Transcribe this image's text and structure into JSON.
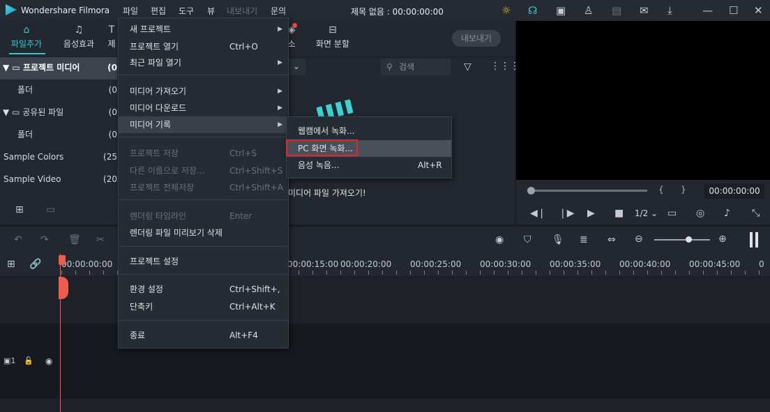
{
  "app": {
    "name": "Wondershare Filmora",
    "doc_title": "제목 없음 : 00:00:00:00"
  },
  "menubar": [
    "파일",
    "편집",
    "도구",
    "뷰",
    "내보내기",
    "문의"
  ],
  "title_icons": [
    "bulb-icon",
    "headset-icon",
    "gift-icon",
    "user-icon",
    "save-icon",
    "mail-icon",
    "download-icon",
    "minimize-icon",
    "maximize-icon",
    "close-icon"
  ],
  "tabs": [
    {
      "label": "파일추가",
      "icon": "folder-icon"
    },
    {
      "label": "음성효과",
      "icon": "music-icon"
    },
    {
      "label": "소",
      "icon": "element-icon"
    },
    {
      "label": "화면 분할",
      "icon": "split-screen-icon"
    }
  ],
  "tab_partial_left": "제",
  "export_label": "내보내기",
  "tree": [
    {
      "label": "프로젝트 미디어",
      "count": "(0",
      "expand": true
    },
    {
      "label": "폴더",
      "count": "(0"
    },
    {
      "label": "공유된 파일",
      "count": "(0",
      "expand": true
    },
    {
      "label": "폴더",
      "count": "(0"
    },
    {
      "label": "Sample Colors",
      "count": "(25"
    },
    {
      "label": "Sample Video",
      "count": "(20"
    }
  ],
  "search_placeholder": "검색",
  "empty_text": "미디어 파일 가져오기!",
  "preview": {
    "time": "00:00:00:00",
    "ratio": "1/2"
  },
  "ruler_labels": [
    "00:00:00:00",
    "00:00:15:00",
    "00:00:20:00",
    "00:00:25:00",
    "00:00:30:00",
    "00:00:35:00",
    "00:00:40:00",
    "00:00:45:00",
    "0"
  ],
  "file_menu": [
    {
      "label": "새 프로젝트",
      "shortcut": "",
      "arrow": true
    },
    {
      "label": "프로젝트 열기",
      "shortcut": "Ctrl+O"
    },
    {
      "label": "최근 파일 열기",
      "shortcut": "",
      "arrow": true
    },
    {
      "label": "미디어 가져오기",
      "shortcut": "",
      "arrow": true
    },
    {
      "label": "미디어 다운로드",
      "shortcut": "",
      "arrow": true
    },
    {
      "label": "미디어 기록",
      "shortcut": "",
      "arrow": true
    },
    {
      "label": "프로젝트 저장",
      "shortcut": "Ctrl+S",
      "disabled": true
    },
    {
      "label": "다른 이름으로 저장...",
      "shortcut": "Ctrl+Shift+S",
      "disabled": true
    },
    {
      "label": "프로젝트 전체저장",
      "shortcut": "Ctrl+Shift+A",
      "disabled": true
    },
    {
      "label": "렌더링 타임라인",
      "shortcut": "Enter",
      "disabled": true
    },
    {
      "label": "렌더링 파일 미리보기 삭제",
      "shortcut": ""
    },
    {
      "label": "프로젝트 설정",
      "shortcut": ""
    },
    {
      "label": "환경 설정",
      "shortcut": "Ctrl+Shift+,"
    },
    {
      "label": "단축키",
      "shortcut": "Ctrl+Alt+K"
    },
    {
      "label": "종료",
      "shortcut": "Alt+F4"
    }
  ],
  "sub_menu": [
    {
      "label": "웹캠에서 녹화...",
      "shortcut": ""
    },
    {
      "label": "PC 화면 녹화...",
      "shortcut": ""
    },
    {
      "label": "음성 녹음...",
      "shortcut": "Alt+R"
    }
  ],
  "colors": {
    "accent": "#35c9d8",
    "playhead": "#ef5b4d",
    "highlight_box": "#e0262d"
  }
}
